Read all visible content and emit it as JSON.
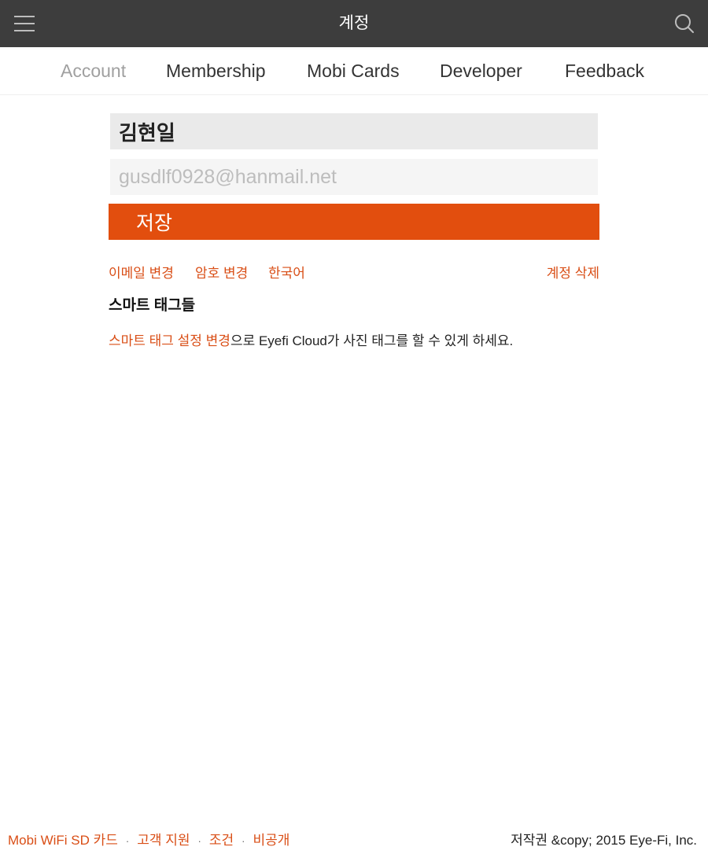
{
  "header": {
    "title": "계정",
    "menu_icon": "hamburger-menu-icon",
    "search_icon": "search-icon",
    "background": "#3d3d3d"
  },
  "tabs": [
    {
      "label": "Account",
      "active": true
    },
    {
      "label": "Membership",
      "active": false
    },
    {
      "label": "Mobi Cards",
      "active": false
    },
    {
      "label": "Developer",
      "active": false
    },
    {
      "label": "Feedback",
      "active": false
    }
  ],
  "form": {
    "name_value": "김현일",
    "email_placeholder": "gusdlf0928@hanmail.net",
    "save_label": "저장"
  },
  "links": {
    "change_email": "이메일 변경",
    "change_password": "암호 변경",
    "language": "한국어",
    "delete_account": "계정 삭제"
  },
  "smart_tags": {
    "heading": "스마트 태그들",
    "link_text": "스마트 태그 설정 변경",
    "text_rest": "으로 Eyefi Cloud가 사진 태그를 할 수 있게 하세요."
  },
  "footer": {
    "links": [
      "Mobi WiFi SD 카드",
      "고객 지원",
      "조건",
      "비공개"
    ],
    "separator": "·",
    "copyright": "저작권 &copy; 2015 Eye-Fi, Inc."
  },
  "colors": {
    "accent": "#e24e0e",
    "link": "#d94e16"
  }
}
